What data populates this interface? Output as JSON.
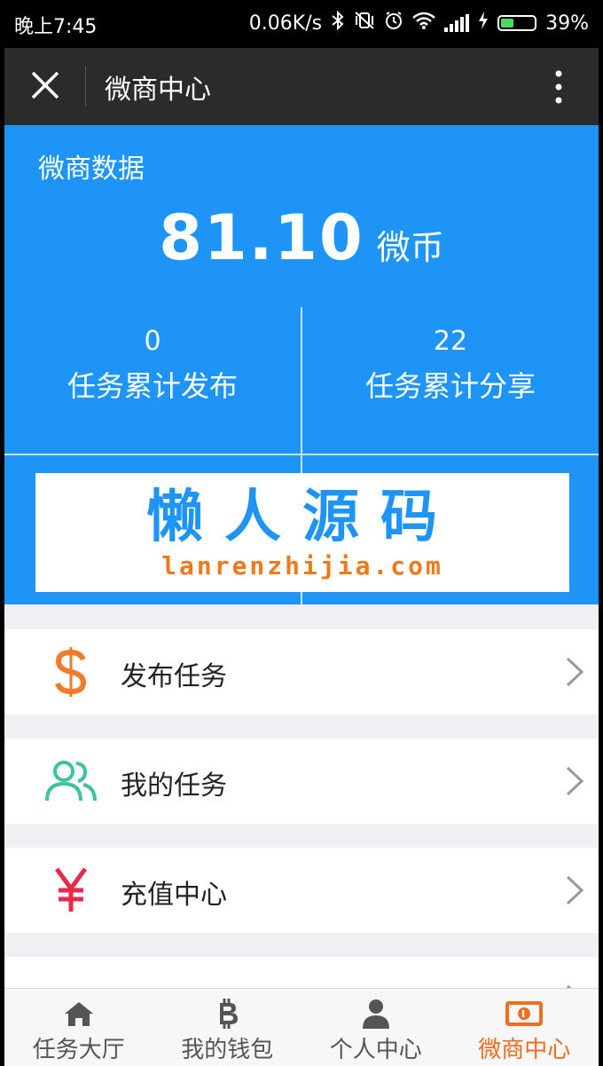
{
  "status_bar": {
    "time": "晚上7:45",
    "network_speed": "0.06K/s",
    "battery": "39%"
  },
  "title_bar": {
    "title": "微商中心"
  },
  "data_panel": {
    "label": "微商数据",
    "amount": "81.10",
    "unit": "微币",
    "stats": [
      {
        "value": "0",
        "label": "任务累计发布"
      },
      {
        "value": "22",
        "label": "任务累计分享"
      }
    ]
  },
  "watermark": {
    "text_cn": "懒人源码",
    "text_en": "lanrenzhijia.com"
  },
  "menu": {
    "items": [
      {
        "label": "发布任务",
        "icon": "dollar-icon"
      },
      {
        "label": "我的任务",
        "icon": "users-icon"
      },
      {
        "label": "充值中心",
        "icon": "yen-icon"
      },
      {
        "label": "",
        "icon": "cards-icon"
      }
    ]
  },
  "bottom_nav": {
    "items": [
      {
        "label": "任务大厅",
        "icon": "home-icon"
      },
      {
        "label": "我的钱包",
        "icon": "bitcoin-icon"
      },
      {
        "label": "个人中心",
        "icon": "person-icon"
      },
      {
        "label": "微商中心",
        "icon": "money-icon",
        "active": true
      }
    ]
  },
  "colors": {
    "primary_blue": "#1d94f6",
    "accent_orange": "#f06c1e",
    "title_bar_bg": "#2b2b2b"
  }
}
